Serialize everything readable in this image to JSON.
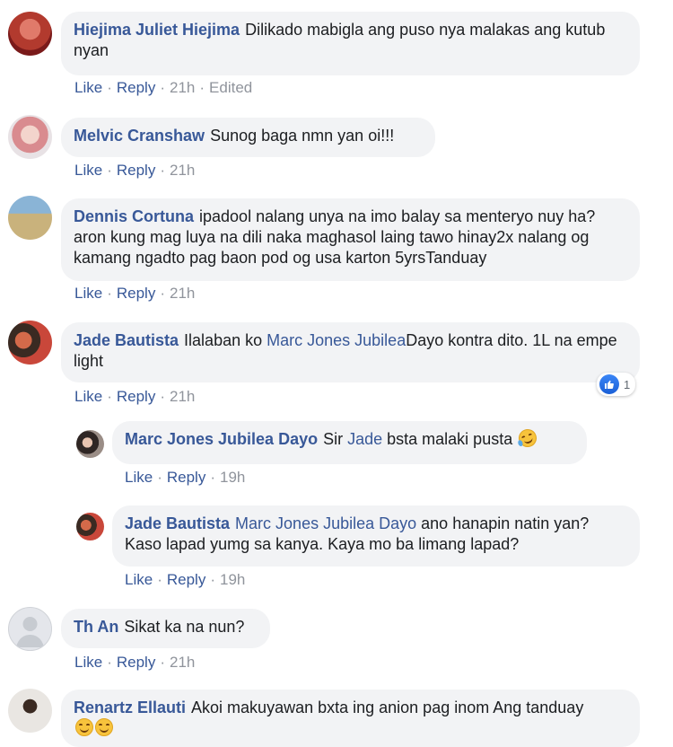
{
  "comments": [
    {
      "author": "Hiejima Juliet Hiejima",
      "text": "Dilikado mabigla ang puso nya malakas ang kutub nyan",
      "actions": {
        "like": "Like",
        "reply": "Reply",
        "time": "21h",
        "edited": "Edited"
      }
    },
    {
      "author": "Melvic Cranshaw",
      "text": "Sunog baga nmn yan oi!!!",
      "actions": {
        "like": "Like",
        "reply": "Reply",
        "time": "21h"
      }
    },
    {
      "author": "Dennis Cortuna",
      "text": "ipadool nalang unya na imo balay sa menteryo nuy ha? aron kung mag luya na dili naka maghasol laing tawo hinay2x nalang og kamang ngadto pag baon pod og usa karton 5yrsTanduay",
      "actions": {
        "like": "Like",
        "reply": "Reply",
        "time": "21h"
      }
    },
    {
      "author": "Jade Bautista",
      "text_before": "Ilalaban ko ",
      "mention": "Marc Jones Jubilea",
      "text_after": "Dayo kontra dito. 1L na empe light",
      "actions": {
        "like": "Like",
        "reply": "Reply",
        "time": "21h"
      },
      "reaction": {
        "icon": "like-icon",
        "count": "1"
      }
    },
    {
      "author": "Marc Jones Jubilea Dayo",
      "text_before": "Sir ",
      "mention": "Jade",
      "text_after": " bsta malaki pusta",
      "emoji": "laughing-emoji",
      "actions": {
        "like": "Like",
        "reply": "Reply",
        "time": "19h"
      }
    },
    {
      "author": "Jade Bautista",
      "mention": "Marc Jones Jubilea Dayo",
      "text_after": " ano hanapin natin yan? Kaso lapad yumg sa kanya. Kaya mo ba limang lapad?",
      "actions": {
        "like": "Like",
        "reply": "Reply",
        "time": "19h"
      }
    },
    {
      "author": "Th An",
      "text": "Sikat ka na nun?",
      "actions": {
        "like": "Like",
        "reply": "Reply",
        "time": "21h"
      }
    },
    {
      "author": "Renartz Ellauti",
      "text": "Akoi makuyawan bxta ing anion pag inom Ang tanduay",
      "emoji": "smiling-emoji"
    }
  ],
  "colors": {
    "link": "#385898",
    "bubble": "#f2f3f5",
    "meta": "#90949c"
  }
}
